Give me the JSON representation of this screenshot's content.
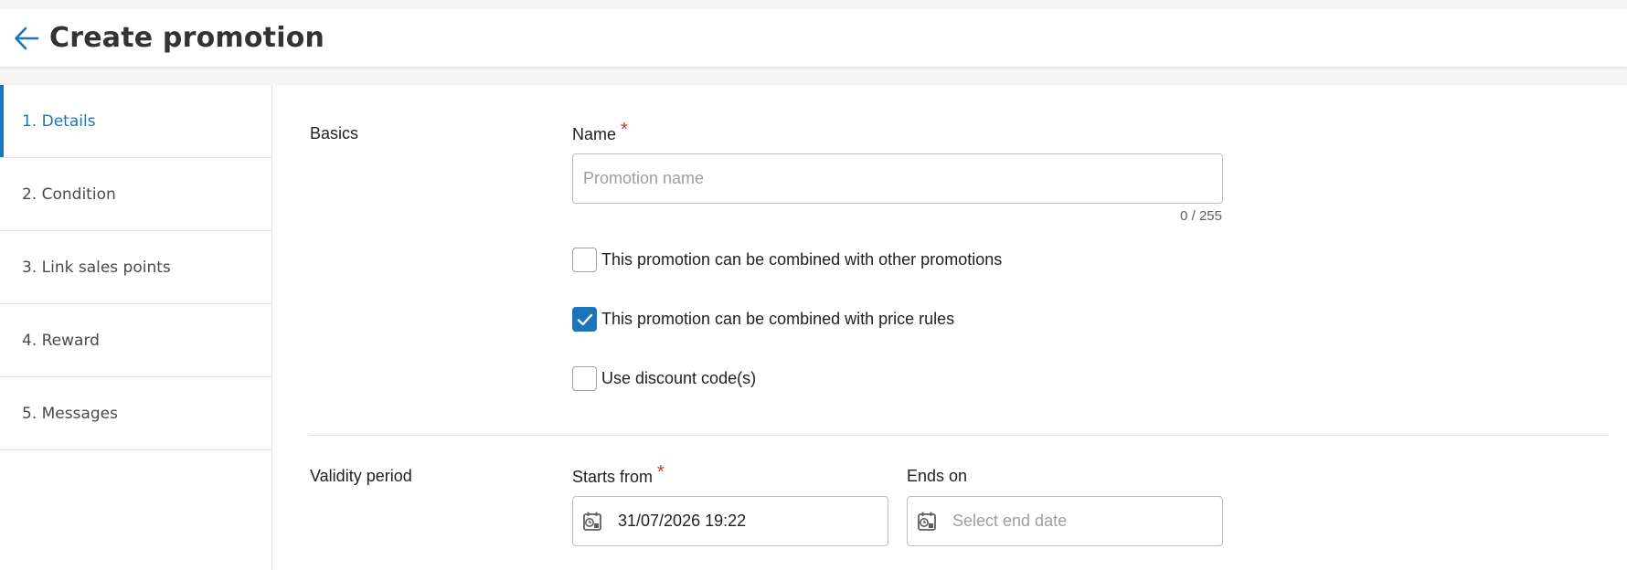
{
  "header": {
    "title": "Create promotion"
  },
  "steps": [
    {
      "label": "1. Details"
    },
    {
      "label": "2. Condition"
    },
    {
      "label": "3. Link sales points"
    },
    {
      "label": "4. Reward"
    },
    {
      "label": "5. Messages"
    }
  ],
  "basics": {
    "section_label": "Basics",
    "name_label": "Name",
    "required_mark": "*",
    "name_placeholder": "Promotion name",
    "name_value": "",
    "counter": "0 / 255",
    "checkboxes": [
      {
        "label": "This promotion can be combined with other promotions",
        "checked": false
      },
      {
        "label": "This promotion can be combined with price rules",
        "checked": true
      },
      {
        "label": "Use discount code(s)",
        "checked": false
      }
    ]
  },
  "validity": {
    "section_label": "Validity period",
    "starts_label": "Starts from",
    "required_mark": "*",
    "starts_value": "31/07/2026 19:22",
    "ends_label": "Ends on",
    "ends_placeholder": "Select end date"
  },
  "colors": {
    "accent": "#1b75bb",
    "required": "#d32f2f"
  }
}
